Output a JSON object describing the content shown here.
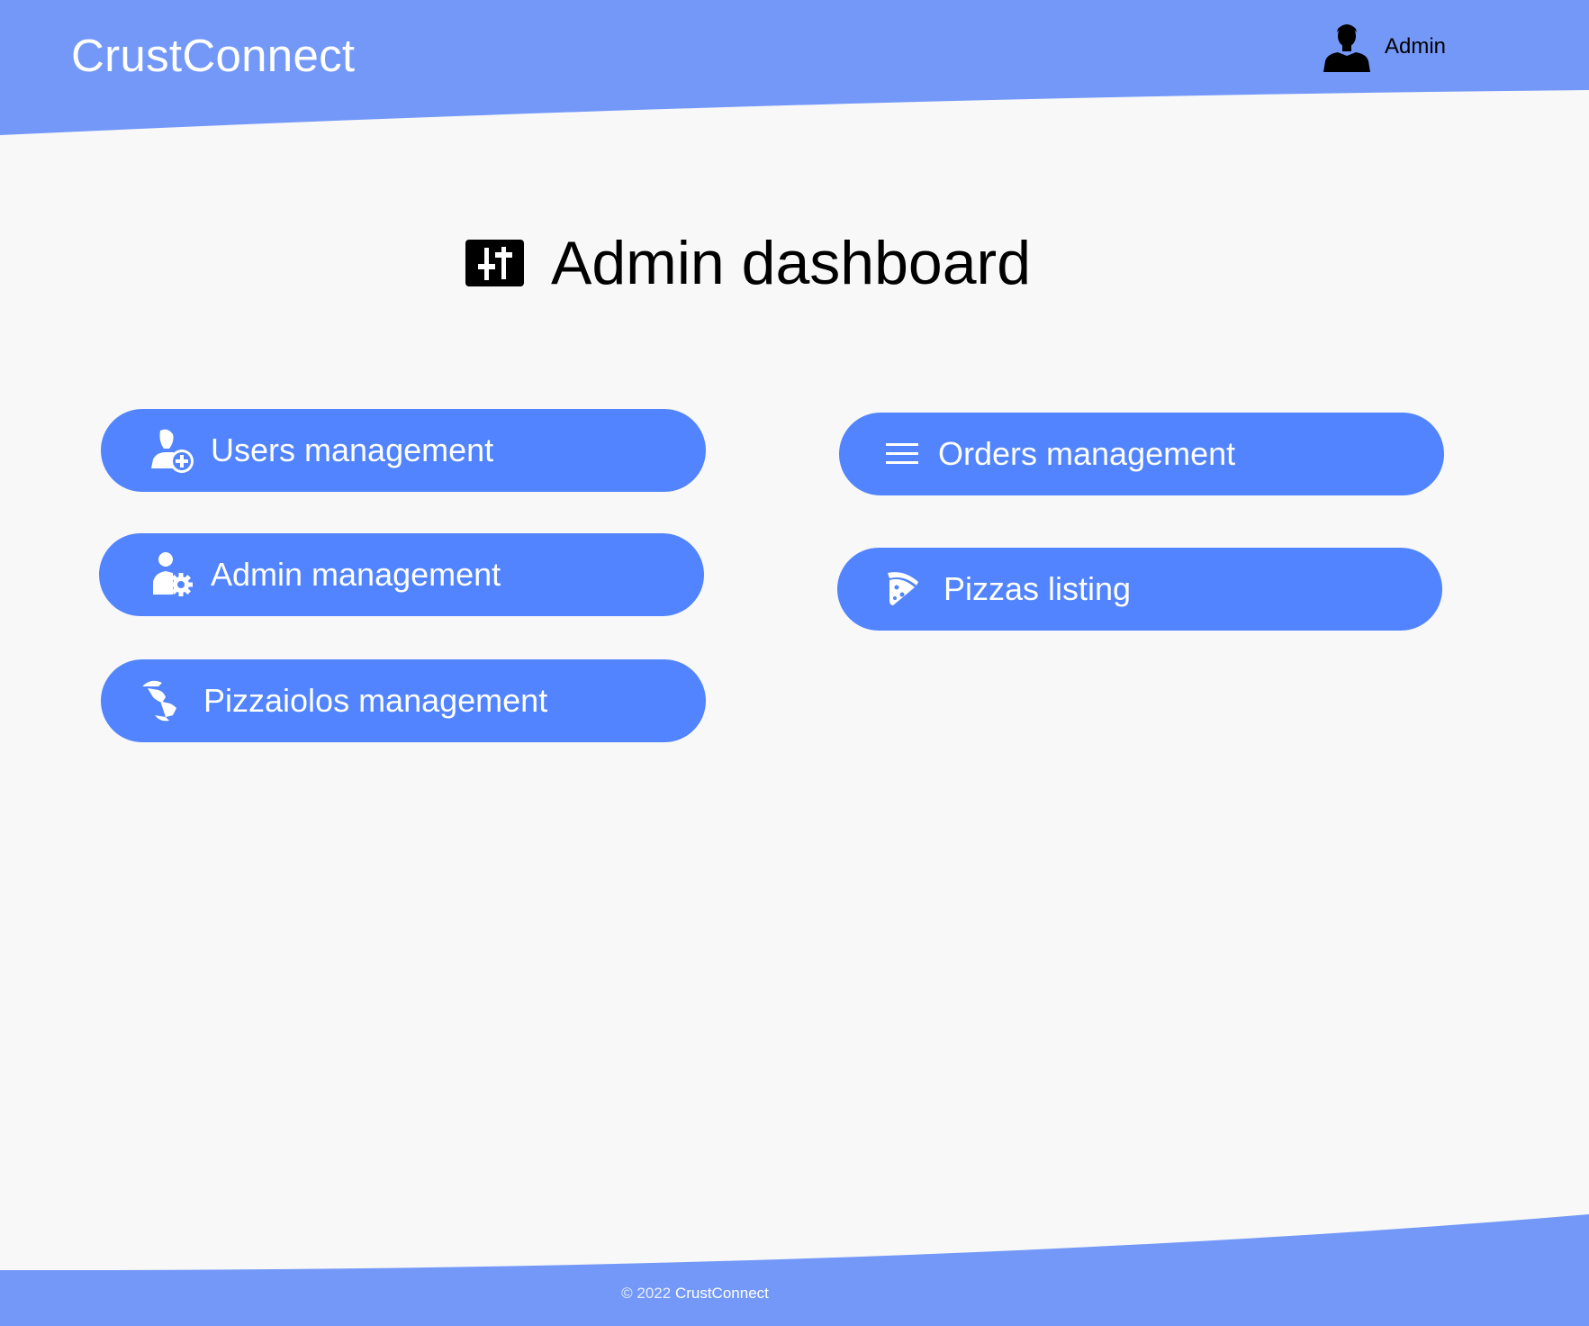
{
  "app": {
    "brand": "CrustConnect"
  },
  "header": {
    "user_name": "Admin"
  },
  "page": {
    "title": "Admin dashboard"
  },
  "nav": {
    "left": [
      {
        "label": "Users management",
        "icon": "user-plus-icon"
      },
      {
        "label": "Admin management",
        "icon": "user-gear-icon"
      },
      {
        "label": "Pizzaiolos management",
        "icon": "pizzaiolo-icon"
      }
    ],
    "right": [
      {
        "label": "Orders management",
        "icon": "list-icon"
      },
      {
        "label": "Pizzas listing",
        "icon": "pizza-slice-icon"
      }
    ]
  },
  "footer": {
    "copyright": "© 2022",
    "brand": "CrustConnect"
  },
  "colors": {
    "header_bg": "#7398f8",
    "button_bg": "#5184fe",
    "page_bg": "#f8f8f8",
    "text_dark": "#000000",
    "text_light": "#ffffff"
  }
}
